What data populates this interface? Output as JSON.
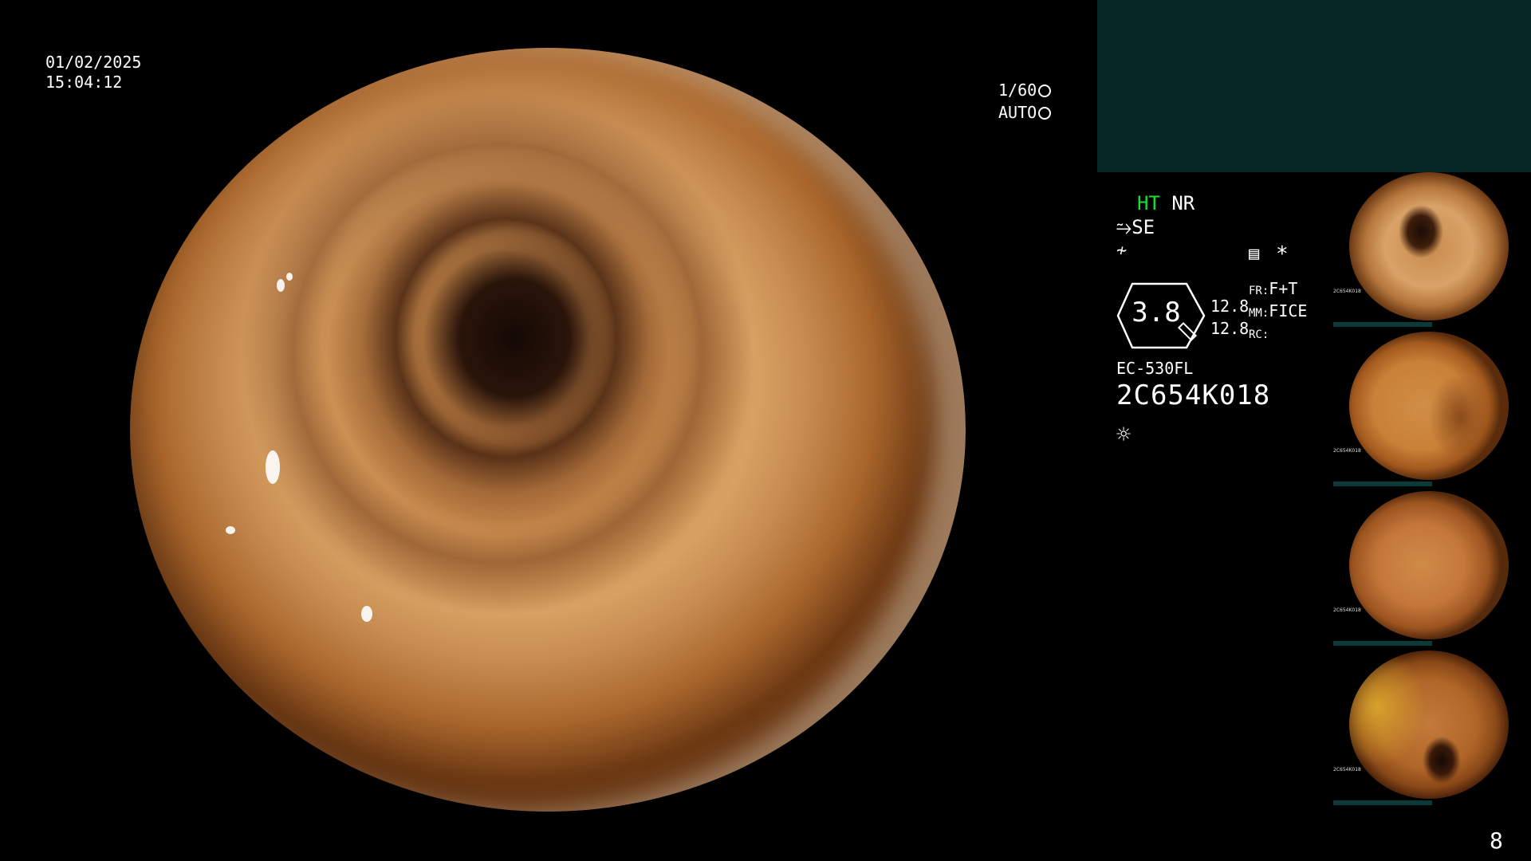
{
  "overlay": {
    "date": "01/02/2025",
    "time": "15:04:12",
    "shutter": "1/60",
    "exposure": "AUTO"
  },
  "settings": {
    "ht": "HT",
    "nr": "NR",
    "se": "SE",
    "zoom": "3.8",
    "val1": "12.8",
    "val2": "12.8",
    "fr_label": "FR:",
    "fr_value": "F+T",
    "mm_label": "MM:",
    "mm_value": "FICE",
    "rc_label": "RC:",
    "asterisk": "*"
  },
  "scope": {
    "model": "EC-530FL",
    "serial": "2C654K018"
  },
  "thumbnails": [
    {
      "caption": "2C654K018"
    },
    {
      "caption": "2C654K018"
    },
    {
      "caption": "2C654K018"
    },
    {
      "caption": "2C654K018"
    }
  ],
  "page_number": "8",
  "colors": {
    "teal_panel": "#062726",
    "ht_green": "#19e02a"
  }
}
